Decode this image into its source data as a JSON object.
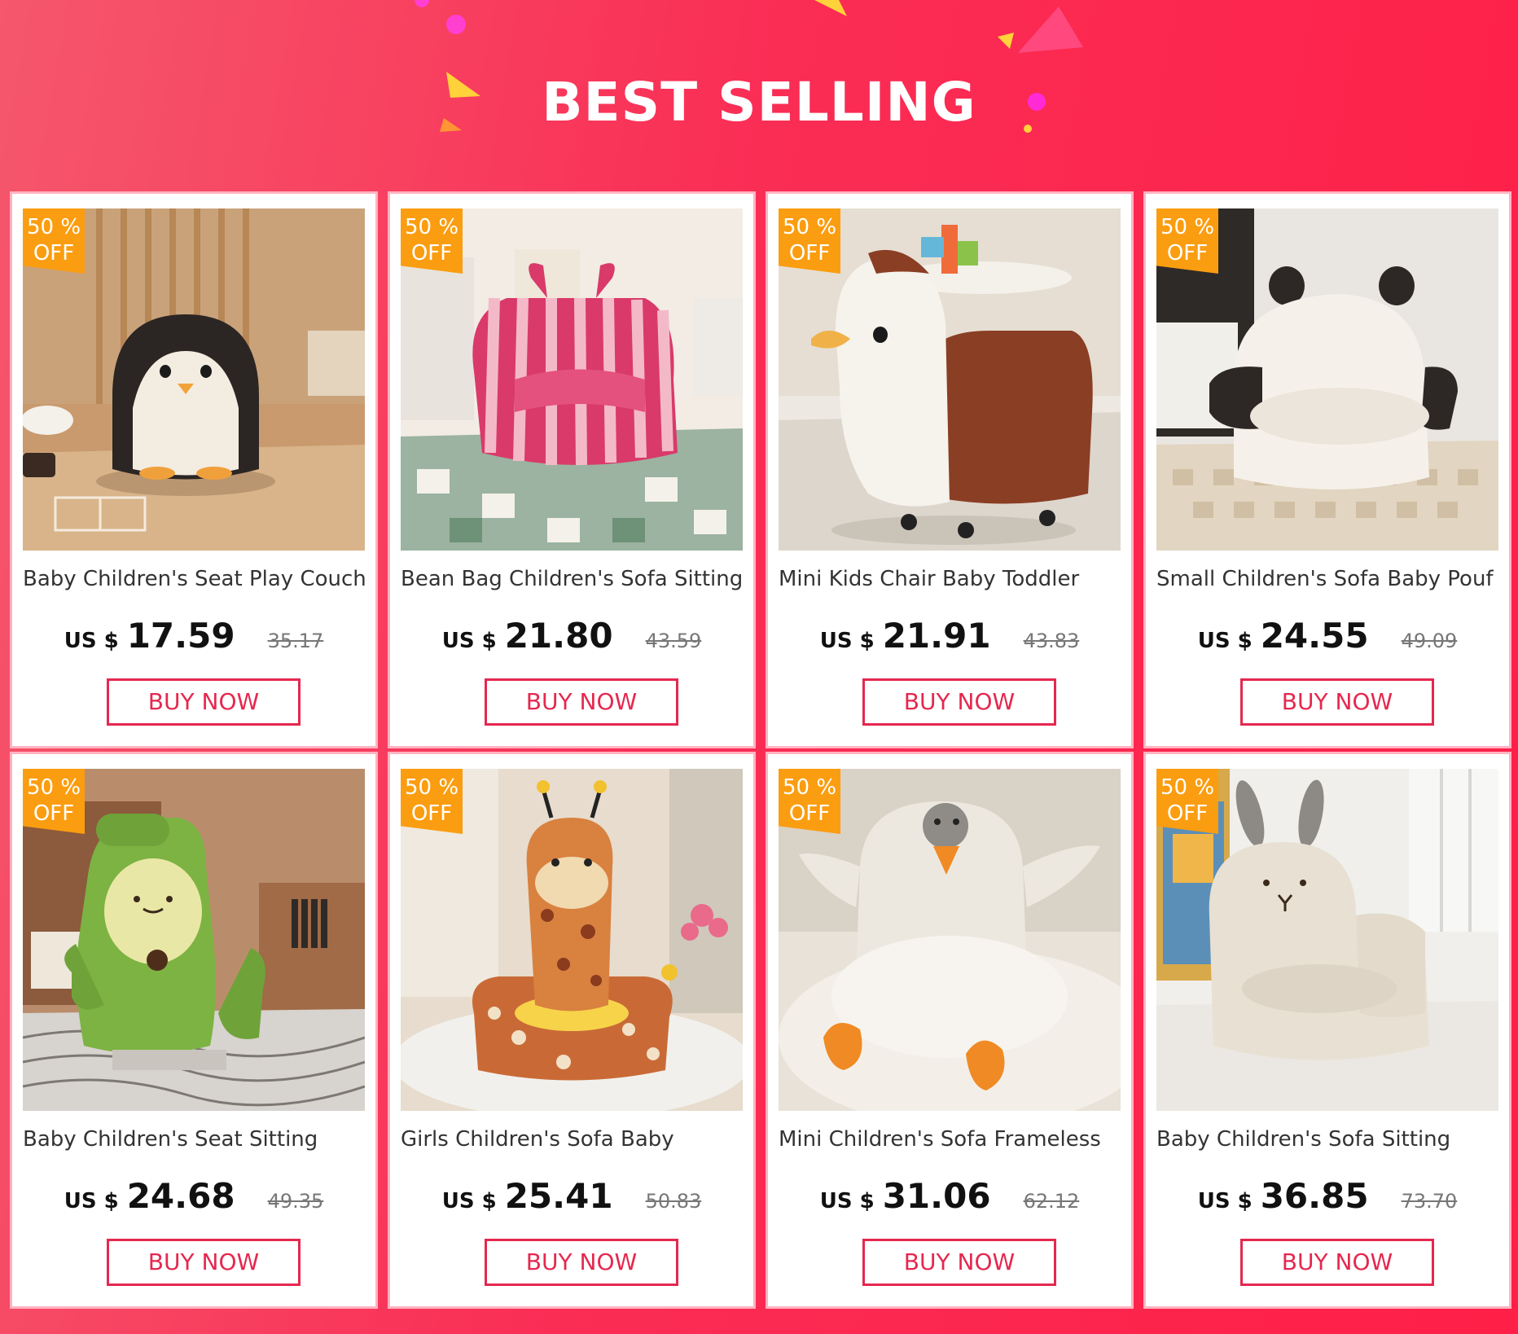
{
  "header": {
    "title": "BEST SELLING",
    "accent_color": "#ff1f47",
    "decorations": [
      "confetti-triangle",
      "confetti-dot"
    ]
  },
  "discount_badge_color": "#fb9d10",
  "button_color": "#e5284f",
  "products": [
    {
      "badge_line1": "50 %",
      "badge_line2": "OFF",
      "name": "Baby Children's Seat Play Couch",
      "currency": "US $",
      "price": "17.59",
      "old_price": "35.17",
      "button": "BUY NOW",
      "image": "penguin-chair-image"
    },
    {
      "badge_line1": "50 %",
      "badge_line2": "OFF",
      "name": "Bean Bag Children's Sofa Sitting",
      "currency": "US $",
      "price": "21.80",
      "old_price": "43.59",
      "button": "BUY NOW",
      "image": "striped-bean-bag-image"
    },
    {
      "badge_line1": "50 %",
      "badge_line2": "OFF",
      "name": "Mini Kids Chair Baby Toddler",
      "currency": "US $",
      "price": "21.91",
      "old_price": "43.83",
      "button": "BUY NOW",
      "image": "duck-stool-image"
    },
    {
      "badge_line1": "50 %",
      "badge_line2": "OFF",
      "name": "Small Children's Sofa Baby Pouf",
      "currency": "US $",
      "price": "24.55",
      "old_price": "49.09",
      "button": "BUY NOW",
      "image": "panda-sofa-image"
    },
    {
      "badge_line1": "50 %",
      "badge_line2": "OFF",
      "name": "Baby Children's Seat Sitting",
      "currency": "US $",
      "price": "24.68",
      "old_price": "49.35",
      "button": "BUY NOW",
      "image": "avocado-sofa-image"
    },
    {
      "badge_line1": "50 %",
      "badge_line2": "OFF",
      "name": "Girls Children's Sofa Baby",
      "currency": "US $",
      "price": "25.41",
      "old_price": "50.83",
      "button": "BUY NOW",
      "image": "giraffe-seat-image"
    },
    {
      "badge_line1": "50 %",
      "badge_line2": "OFF",
      "name": "Mini Children's Sofa Frameless",
      "currency": "US $",
      "price": "31.06",
      "old_price": "62.12",
      "button": "BUY NOW",
      "image": "goose-floor-seat-image"
    },
    {
      "badge_line1": "50 %",
      "badge_line2": "OFF",
      "name": "Baby Children's Sofa Sitting",
      "currency": "US $",
      "price": "36.85",
      "old_price": "73.70",
      "button": "BUY NOW",
      "image": "bunny-sofa-image"
    }
  ]
}
